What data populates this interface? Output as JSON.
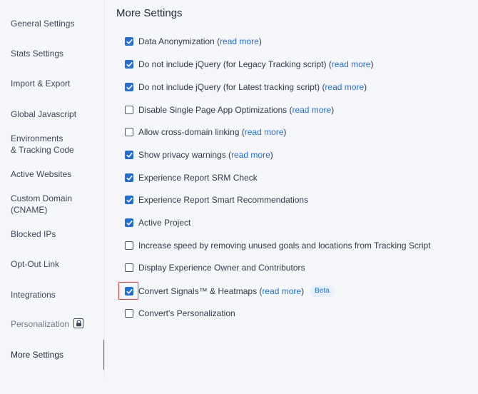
{
  "sidebar": {
    "items": [
      {
        "label": "General Settings"
      },
      {
        "label": "Stats Settings"
      },
      {
        "label": "Import & Export"
      },
      {
        "label": "Global Javascript"
      },
      {
        "label_line1": "Environments",
        "label_line2": "& Tracking Code"
      },
      {
        "label": "Active Websites"
      },
      {
        "label_line1": "Custom Domain",
        "label_line2": "(CNAME)"
      },
      {
        "label": "Blocked IPs"
      },
      {
        "label": "Opt-Out Link"
      },
      {
        "label": "Integrations"
      },
      {
        "label": "Personalization",
        "icon": "lock-icon",
        "locked": true
      },
      {
        "label": "More Settings",
        "active": true
      }
    ]
  },
  "main": {
    "title": "More Settings",
    "read_more": "read more",
    "options": [
      {
        "pre": "Data Anonymization (",
        "link": "read more",
        "post": ")",
        "checked": true
      },
      {
        "pre": "Do not include jQuery (for Legacy Tracking script) (",
        "link": "read more",
        "post": ")",
        "checked": true
      },
      {
        "pre": "Do not include jQuery (for Latest tracking script) (",
        "link": "read more",
        "post": ")",
        "checked": true
      },
      {
        "pre": "Disable Single Page App Optimizations (",
        "link": "read more",
        "post": ")",
        "checked": false
      },
      {
        "pre": "Allow cross-domain linking (",
        "link": "read more",
        "post": ")",
        "checked": false
      },
      {
        "pre": "Show privacy warnings (",
        "link": "read more",
        "post": ")",
        "checked": true
      },
      {
        "pre": "Experience Report SRM Check",
        "checked": true
      },
      {
        "pre": "Experience Report Smart Recommendations",
        "checked": true
      },
      {
        "pre": "Active Project",
        "checked": true
      },
      {
        "pre": "Increase speed by removing unused goals and locations from Tracking Script",
        "checked": false
      },
      {
        "pre": "Display Experience Owner and Contributors",
        "checked": false
      },
      {
        "pre": "Convert Signals™ & Heatmaps (",
        "link": "read more",
        "post": ")",
        "badge": "Beta",
        "checked": true
      },
      {
        "pre": "Convert's Personalization",
        "checked": false
      }
    ]
  },
  "colors": {
    "accent": "#1f6fd6",
    "highlight": "#e0383e",
    "background": "#f5f6fa"
  }
}
